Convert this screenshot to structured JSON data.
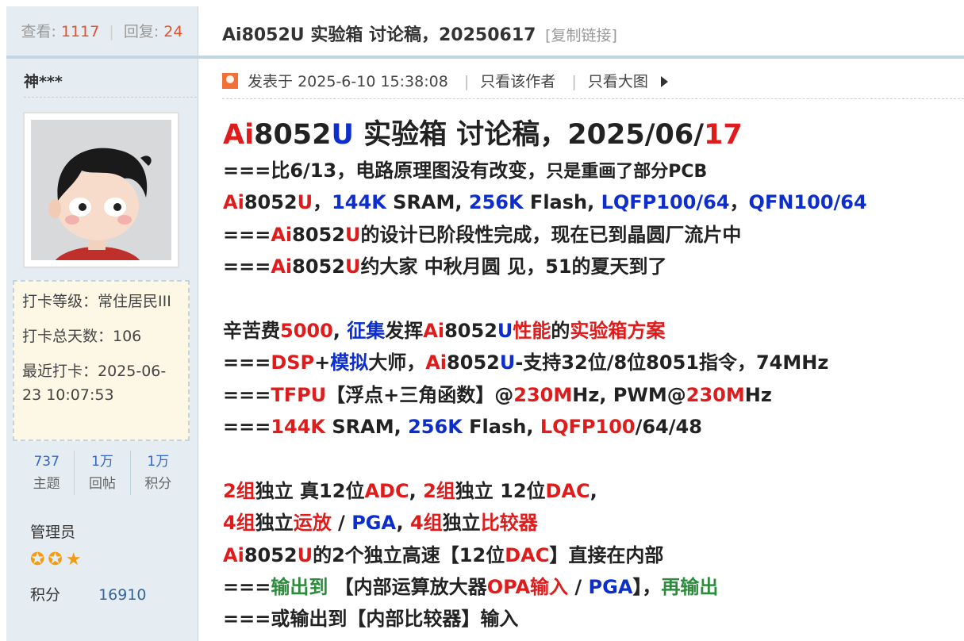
{
  "thread": {
    "views_label": "查看:",
    "views": "1117",
    "replies_label": "回复:",
    "replies": "24",
    "title": "Ai8052U 实验箱 讨论稿，20250617",
    "copy_link": "[复制链接]"
  },
  "author": {
    "name": "神***",
    "checkin_level": "打卡等级：常住居民III",
    "checkin_days": "打卡总天数：106",
    "last_checkin": "最近打卡：2025-06-23 10:07:53",
    "counts": [
      {
        "value": "737",
        "label": "主题"
      },
      {
        "value": "1万",
        "label": "回帖"
      },
      {
        "value": "1万",
        "label": "积分"
      }
    ],
    "role": "管理员",
    "stars": "✪✪★",
    "points_label": "积分",
    "points": "16910"
  },
  "post_meta": {
    "posted": "发表于 2025-6-10 15:38:08",
    "only_author": "只看该作者",
    "only_images": "只看大图"
  },
  "post": {
    "headline": [
      "Ai",
      "8052",
      "U",
      " 实验箱 讨论稿，2025/06/",
      "17"
    ],
    "lines": [
      [
        [
          "n",
          "===比6/13，电路原理图没有改变，"
        ],
        [
          "n sm",
          "只是重画了部分PCB"
        ]
      ],
      [
        [
          "r",
          "Ai"
        ],
        [
          "n",
          "8052"
        ],
        [
          "r",
          "U"
        ],
        [
          "n",
          "，"
        ],
        [
          "b",
          "144K"
        ],
        [
          "n",
          " SRAM, "
        ],
        [
          "b",
          "256K"
        ],
        [
          "n",
          " Flash, "
        ],
        [
          "b",
          "LQFP100/64"
        ],
        [
          "n",
          "，"
        ],
        [
          "b",
          "QFN100/64"
        ]
      ],
      [
        [
          "n",
          "==="
        ],
        [
          "r",
          "Ai"
        ],
        [
          "n",
          "8052"
        ],
        [
          "r",
          "U"
        ],
        [
          "n",
          "的设计已阶段性完成，现在已到晶圆厂流片中"
        ]
      ],
      [
        [
          "n",
          "==="
        ],
        [
          "r",
          "Ai"
        ],
        [
          "n",
          "8052"
        ],
        [
          "r",
          "U"
        ],
        [
          "n",
          "约大家 中秋月圆 见，51的夏天到了"
        ]
      ],
      [],
      [
        [
          "n",
          "辛苦费"
        ],
        [
          "r",
          "5000"
        ],
        [
          "n",
          ", "
        ],
        [
          "b",
          "征集"
        ],
        [
          "n",
          "发挥"
        ],
        [
          "r",
          "Ai"
        ],
        [
          "n",
          "8052"
        ],
        [
          "b",
          "U"
        ],
        [
          "r",
          "性能"
        ],
        [
          "n",
          "的"
        ],
        [
          "r",
          "实验箱方案"
        ]
      ],
      [
        [
          "n",
          "==="
        ],
        [
          "r",
          "DSP"
        ],
        [
          "n",
          "+"
        ],
        [
          "b",
          "模拟"
        ],
        [
          "n",
          "大师，"
        ],
        [
          "r",
          "Ai"
        ],
        [
          "n",
          "8052"
        ],
        [
          "b",
          "U"
        ],
        [
          "n",
          "-支持32位/8位8051指令，74MHz"
        ]
      ],
      [
        [
          "n",
          "==="
        ],
        [
          "r",
          "TFPU"
        ],
        [
          "n",
          "【浮点+三角函数】@"
        ],
        [
          "r",
          "230M"
        ],
        [
          "n",
          "Hz, PWM@"
        ],
        [
          "r",
          "230M"
        ],
        [
          "n",
          "Hz"
        ]
      ],
      [
        [
          "n",
          "==="
        ],
        [
          "r",
          "144K"
        ],
        [
          "n",
          " SRAM, "
        ],
        [
          "b",
          "256K"
        ],
        [
          "n",
          " Flash, "
        ],
        [
          "r",
          "LQFP100"
        ],
        [
          "n",
          "/64/48"
        ]
      ],
      [],
      [
        [
          "r",
          "2组"
        ],
        [
          "n",
          "独立 真12位"
        ],
        [
          "r",
          "ADC"
        ],
        [
          "n",
          ", "
        ],
        [
          "r",
          "2组"
        ],
        [
          "n",
          "独立 12位"
        ],
        [
          "r",
          "DAC"
        ],
        [
          "n",
          ","
        ]
      ],
      [
        [
          "r",
          "4组"
        ],
        [
          "n",
          "独立"
        ],
        [
          "r",
          "运放"
        ],
        [
          "n",
          " / "
        ],
        [
          "b",
          "PGA"
        ],
        [
          "n",
          ", "
        ],
        [
          "r",
          "4组"
        ],
        [
          "n",
          "独立"
        ],
        [
          "r",
          "比较器"
        ]
      ],
      [
        [
          "r",
          "Ai"
        ],
        [
          "n",
          "8052"
        ],
        [
          "r",
          "U"
        ],
        [
          "n",
          "的2个独立高速【12位"
        ],
        [
          "r",
          "DAC"
        ],
        [
          "n",
          "】直接在内部"
        ]
      ],
      [
        [
          "n",
          "==="
        ],
        [
          "g",
          "输出到"
        ],
        [
          "n",
          " 【内部运算放大器"
        ],
        [
          "r",
          "OPA输入"
        ],
        [
          "n",
          " / "
        ],
        [
          "b",
          "PGA"
        ],
        [
          "n",
          "】，"
        ],
        [
          "g",
          "再输出"
        ]
      ],
      [
        [
          "n",
          "===或输出到【内部比较器】输入"
        ]
      ]
    ]
  }
}
